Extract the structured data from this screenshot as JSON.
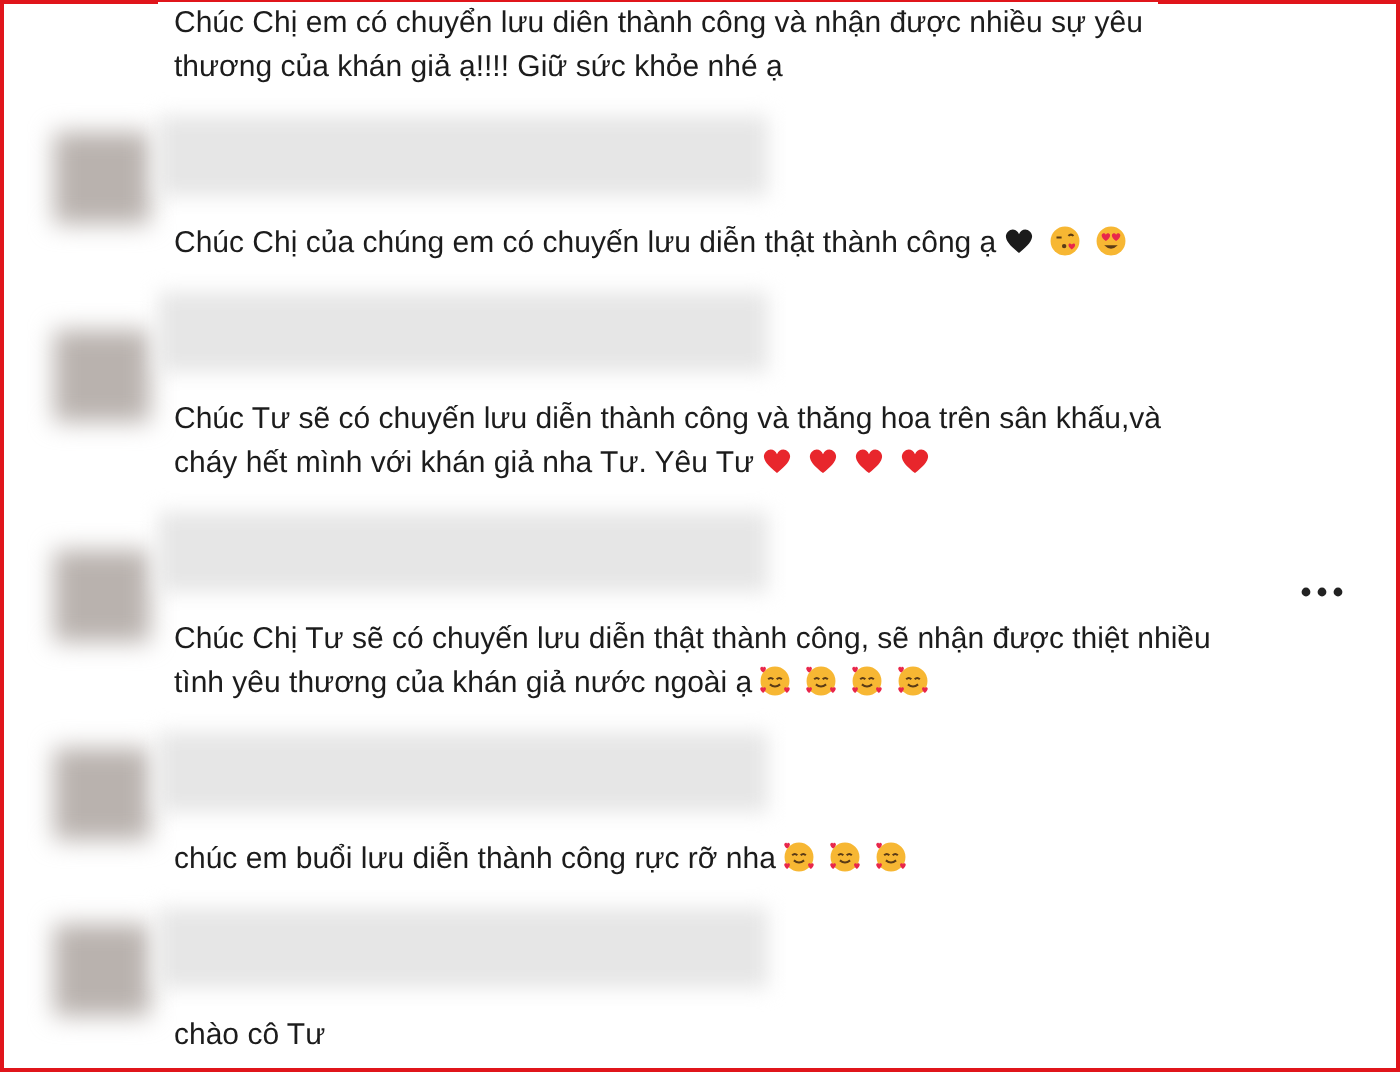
{
  "comments": [
    {
      "show_name": false,
      "show_more_button": false,
      "lines": [
        "Chúc Chị em có chuyển lưu diên thành công và nhận được nhiều sự yêu",
        "thương của khán giả ạ!!!! Giữ sức khỏe nhé ạ"
      ]
    },
    {
      "show_name": true,
      "show_more_button": false,
      "lines": [
        "Chúc Chị của chúng em có chuyến lưu diễn thật thành công ạ"
      ],
      "emojis": [
        {
          "kind": "black-heart"
        },
        {
          "kind": "kiss-face"
        },
        {
          "kind": "heart-eyes-face"
        }
      ]
    },
    {
      "show_name": true,
      "show_more_button": false,
      "lines": [
        "Chúc Tư sẽ có chuyến lưu diễn thành công và thăng hoa trên sân khấu,và",
        "cháy hết mình với khán giả nha Tư. Yêu Tư"
      ],
      "emojis": [
        {
          "kind": "red-heart"
        },
        {
          "kind": "red-heart"
        },
        {
          "kind": "red-heart"
        },
        {
          "kind": "red-heart"
        }
      ]
    },
    {
      "show_name": true,
      "show_more_button": true,
      "lines": [
        "Chúc Chị Tư sẽ có chuyến lưu diễn thật thành công, sẽ nhận được thiệt nhiều",
        "tình yêu thương của khán giả nước ngoài ạ"
      ],
      "emojis": [
        {
          "kind": "hearts-face"
        },
        {
          "kind": "hearts-face"
        },
        {
          "kind": "hearts-face"
        },
        {
          "kind": "hearts-face"
        }
      ]
    },
    {
      "show_name": true,
      "show_more_button": false,
      "lines": [
        "chúc em buổi lưu diễn thành công rực rỡ nha"
      ],
      "emojis": [
        {
          "kind": "hearts-face"
        },
        {
          "kind": "hearts-face"
        },
        {
          "kind": "hearts-face"
        }
      ]
    },
    {
      "show_name": true,
      "show_more_button": false,
      "lines": [
        "chào cô Tư"
      ]
    }
  ]
}
